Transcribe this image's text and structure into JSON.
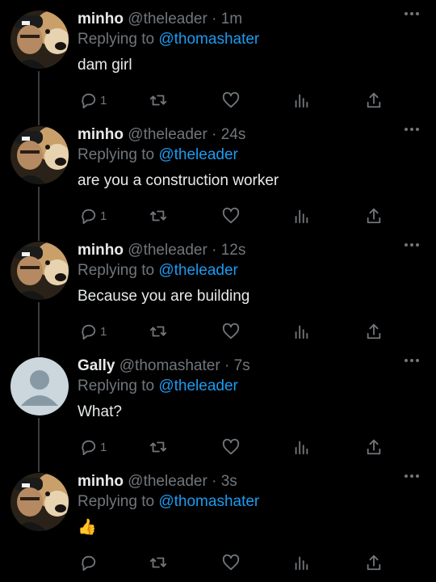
{
  "tweets": [
    {
      "avatar": "minho-avatar",
      "name": "minho",
      "handle": "@theleader",
      "sep": "·",
      "time": "1m",
      "replying_prefix": "Replying to ",
      "replying_to": "@thomashater",
      "text": "dam girl",
      "reply_count": "1"
    },
    {
      "avatar": "minho-avatar",
      "name": "minho",
      "handle": "@theleader",
      "sep": "·",
      "time": "24s",
      "replying_prefix": "Replying to ",
      "replying_to": "@theleader",
      "text": "are you a construction worker",
      "reply_count": "1"
    },
    {
      "avatar": "minho-avatar",
      "name": "minho",
      "handle": "@theleader",
      "sep": "·",
      "time": "12s",
      "replying_prefix": "Replying to ",
      "replying_to": "@theleader",
      "text": "Because you are building",
      "reply_count": "1"
    },
    {
      "avatar": "default-avatar",
      "name": "Gally",
      "handle": "@thomashater",
      "sep": "·",
      "time": "7s",
      "replying_prefix": "Replying to ",
      "replying_to": "@theleader",
      "text": "What?",
      "reply_count": "1"
    },
    {
      "avatar": "minho-avatar",
      "name": "minho",
      "handle": "@theleader",
      "sep": "·",
      "time": "3s",
      "replying_prefix": "Replying to ",
      "replying_to": "@thomashater",
      "text": "👍",
      "reply_count": ""
    }
  ],
  "icons": {
    "reply": "reply-icon",
    "retweet": "retweet-icon",
    "like": "like-icon",
    "views": "views-icon",
    "share": "share-icon",
    "more": "more-icon"
  },
  "colors": {
    "background": "#000000",
    "text": "#e7e9ea",
    "secondary": "#71767b",
    "link": "#1d9bf0",
    "thread_line": "#3a3d40"
  }
}
